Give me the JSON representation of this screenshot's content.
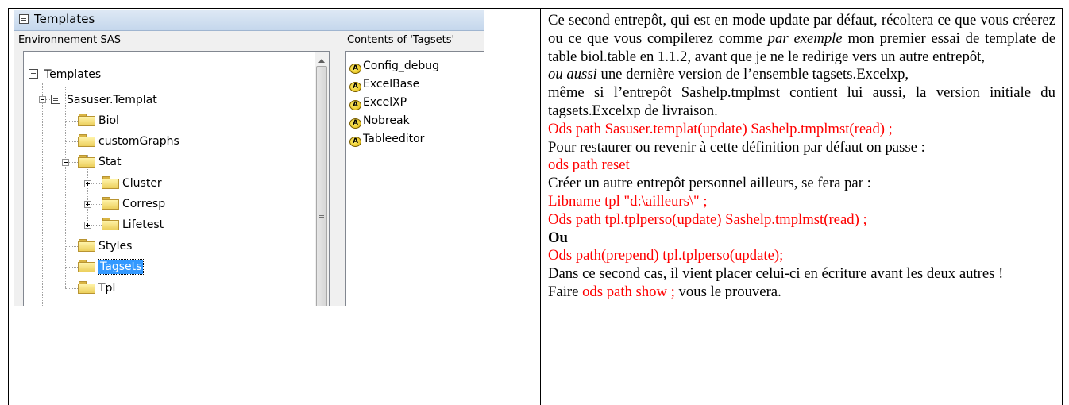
{
  "sas_window": {
    "title": "Templates",
    "left_pane_label": "Environnement SAS",
    "right_pane_label": "Contents of 'Tagsets'",
    "tree": {
      "root": "Templates",
      "library": "Sasuser.Templat",
      "folders": [
        "Biol",
        "customGraphs",
        "Stat",
        "Cluster",
        "Corresp",
        "Lifetest",
        "Styles",
        "Tagsets",
        "Tpl"
      ],
      "selected": "Tagsets"
    },
    "contents": [
      "Config_debug",
      "ExcelBase",
      "ExcelXP",
      "Nobreak",
      "Tableeditor"
    ],
    "tagset_icon_letter": "A"
  },
  "text": {
    "p1_a": "Ce second entrepôt, qui est en mode update par défaut, récoltera ce que vous créerez ou ce que vous compilerez comme ",
    "p1_italic": "par exemple",
    "p1_b": " mon premier essai de template de table biol.table en 1.1.2,  avant que je ne le redirige vers un autre entrepôt,",
    "p2_italic": "ou aussi",
    "p2_b": "  une dernière version de l’ensemble tagsets.Excelxp,",
    "p3": "même si l’entrepôt Sashelp.tmplmst contient lui aussi, la  version initiale  du tagsets.Excelxp de livraison.",
    "code1": "Ods path   Sasuser.templat(update)  Sashelp.tmplmst(read) ;",
    "p4": "Pour restaurer ou revenir à cette définition par défaut on passe :",
    "code2": "ods path reset",
    "p5": "Créer un autre entrepôt personnel ailleurs, se fera par :",
    "code3": "Libname   tpl  \"d:\\ailleurs\\\" ;",
    "code4": "Ods path   tpl.tplperso(update)  Sashelp.tmplmst(read) ;",
    "ou": "Ou",
    "code5": "Ods path(prepend)  tpl.tplperso(update);",
    "p6": "Dans ce second cas,  il vient placer celui-ci en écriture avant les deux autres !",
    "p7_a": "Faire   ",
    "p7_code": "ods path show ;",
    "p7_b": "      vous le prouvera."
  },
  "colors": {
    "code_red": "#ff0000",
    "selection_blue": "#3399ff"
  }
}
